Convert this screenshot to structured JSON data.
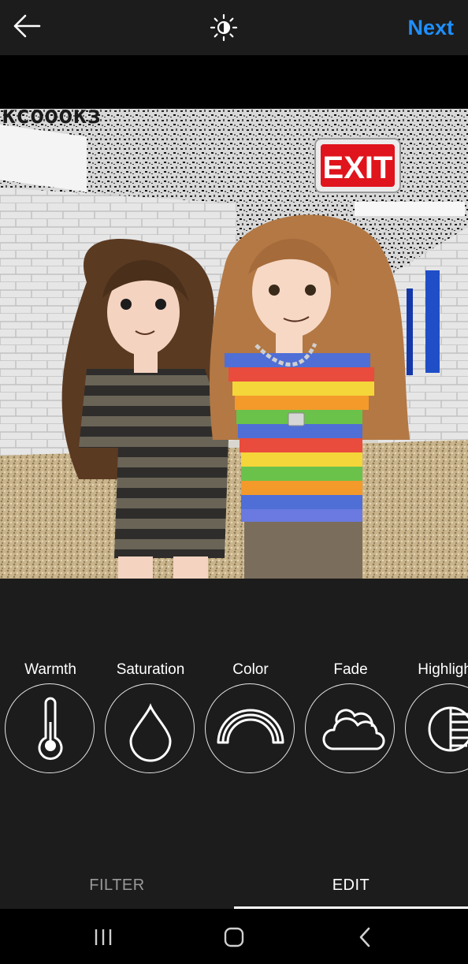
{
  "header": {
    "back_icon": "arrow-left-icon",
    "lux_icon": "sun-lux-icon",
    "next_label": "Next",
    "accent_color": "#1f8fff"
  },
  "photo": {
    "sign_text": "EXIT",
    "wall_text": "ксооокз"
  },
  "tools": [
    {
      "label": "Warmth",
      "icon": "thermometer-icon"
    },
    {
      "label": "Saturation",
      "icon": "droplet-icon"
    },
    {
      "label": "Color",
      "icon": "rainbow-icon"
    },
    {
      "label": "Fade",
      "icon": "cloud-icon"
    },
    {
      "label": "Highlights",
      "icon": "highlights-icon"
    }
  ],
  "tabs": {
    "filter_label": "FILTER",
    "edit_label": "EDIT",
    "active": "EDIT"
  },
  "system_nav": {
    "recents_icon": "recents-icon",
    "home_icon": "home-icon",
    "back_icon": "system-back-icon"
  }
}
